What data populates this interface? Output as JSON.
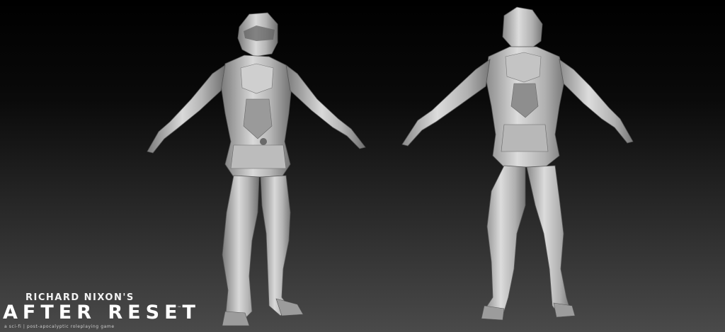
{
  "branding": {
    "author_line": "RICHARD NIXON'S",
    "title": "AFTER RESET",
    "trademark": "™",
    "tagline": "a sci-fi | post-apocalyptic roleplaying game"
  },
  "views": [
    {
      "name": "front-view"
    },
    {
      "name": "back-view"
    }
  ],
  "colors": {
    "background_top": "#000000",
    "background_bottom": "#4a4a4a",
    "model_light": "#d8d8d8",
    "model_mid": "#a8a8a8",
    "model_dark": "#6e6e6e"
  }
}
